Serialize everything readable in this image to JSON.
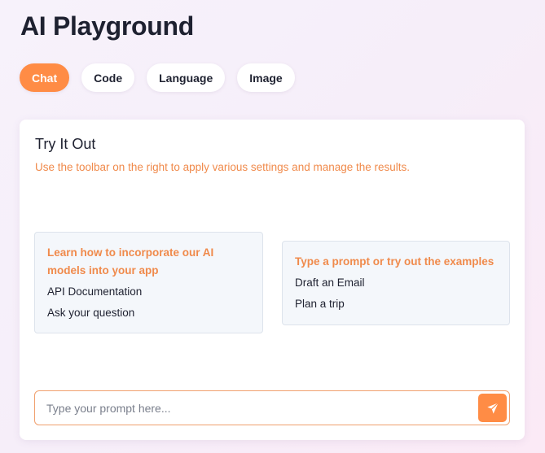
{
  "page": {
    "title": "AI Playground"
  },
  "tabs": [
    {
      "label": "Chat",
      "active": true
    },
    {
      "label": "Code",
      "active": false
    },
    {
      "label": "Language",
      "active": false
    },
    {
      "label": "Image",
      "active": false
    }
  ],
  "card": {
    "title": "Try It Out",
    "subtitle": "Use the toolbar on the right to apply various settings and manage the results.",
    "left_box": {
      "heading": "Learn how to incorporate our AI models into your app",
      "links": [
        "API Documentation",
        "Ask your question"
      ]
    },
    "right_box": {
      "heading": "Type a prompt or try out the examples",
      "links": [
        "Draft an Email",
        "Plan a trip"
      ]
    },
    "prompt": {
      "placeholder": "Type your prompt here...",
      "value": ""
    },
    "send_icon": "paper-plane-icon"
  },
  "colors": {
    "accent": "#ff8c45",
    "text": "#1e2130",
    "box_bg": "#f4f7fb"
  }
}
